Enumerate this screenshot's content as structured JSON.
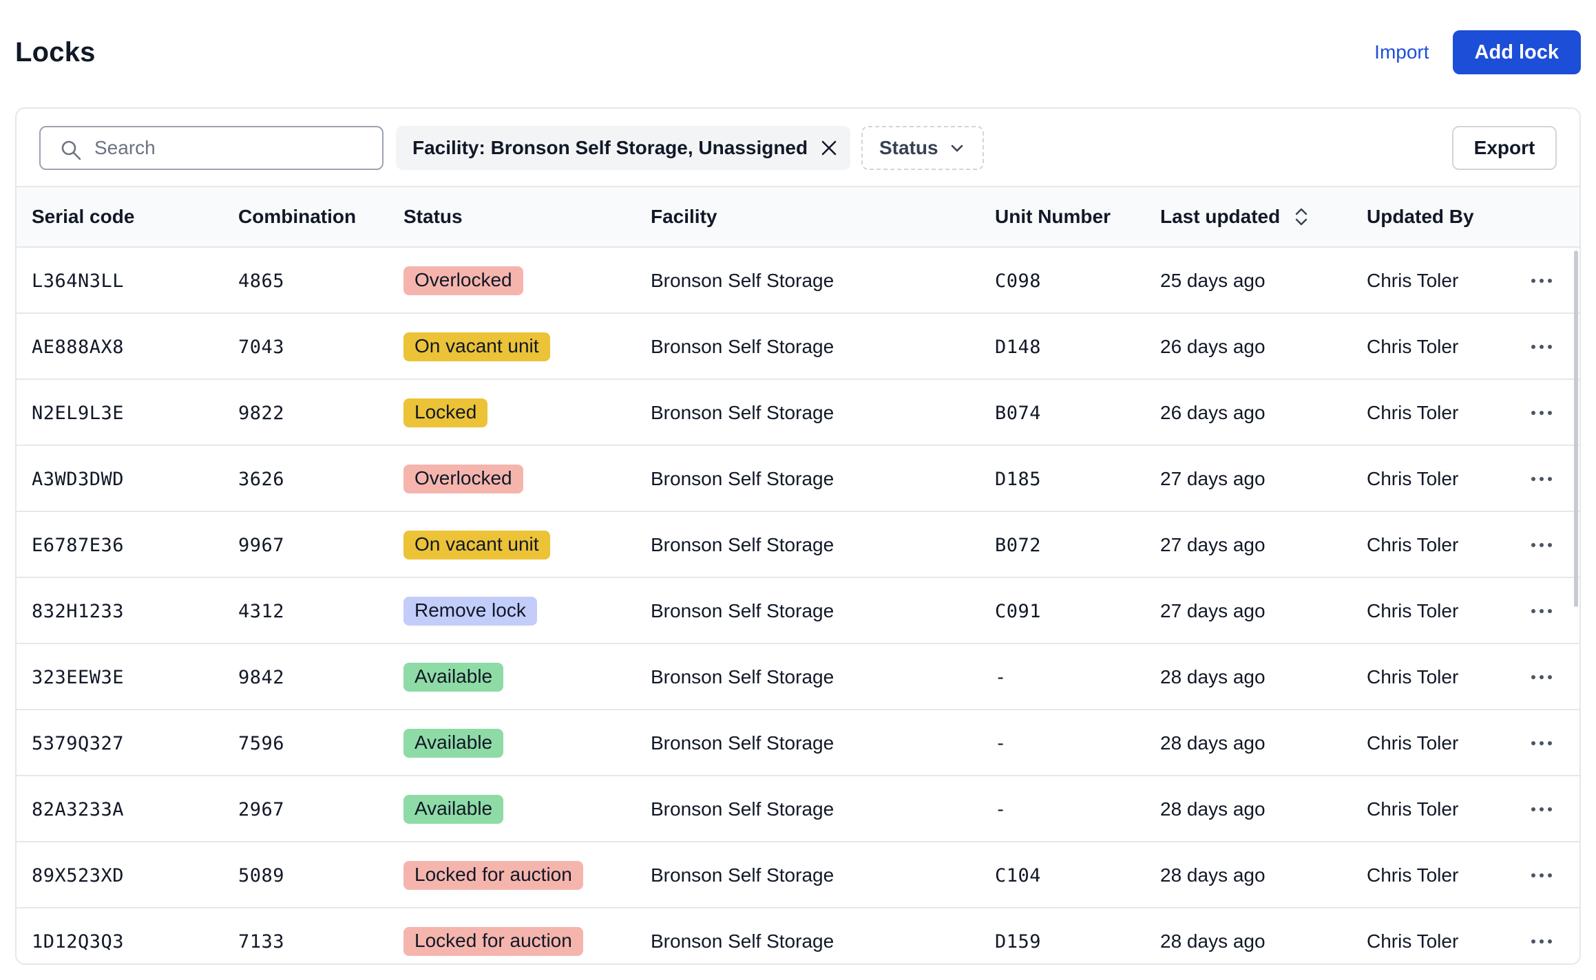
{
  "header": {
    "title": "Locks",
    "import_label": "Import",
    "add_label": "Add lock"
  },
  "toolbar": {
    "search_placeholder": "Search",
    "facility_filter_label": "Facility: Bronson Self Storage, Unassigned",
    "status_filter_label": "Status",
    "export_label": "Export"
  },
  "table": {
    "columns": [
      "Serial code",
      "Combination",
      "Status",
      "Facility",
      "Unit Number",
      "Last updated",
      "Updated By"
    ],
    "sorted_column": "Last updated",
    "rows": [
      {
        "serial": "L364N3LL",
        "combination": "4865",
        "status": "Overlocked",
        "facility": "Bronson Self Storage",
        "unit": "C098",
        "updated": "25 days ago",
        "by": "Chris Toler"
      },
      {
        "serial": "AE888AX8",
        "combination": "7043",
        "status": "On vacant unit",
        "facility": "Bronson Self Storage",
        "unit": "D148",
        "updated": "26 days ago",
        "by": "Chris Toler"
      },
      {
        "serial": "N2EL9L3E",
        "combination": "9822",
        "status": "Locked",
        "facility": "Bronson Self Storage",
        "unit": "B074",
        "updated": "26 days ago",
        "by": "Chris Toler"
      },
      {
        "serial": "A3WD3DWD",
        "combination": "3626",
        "status": "Overlocked",
        "facility": "Bronson Self Storage",
        "unit": "D185",
        "updated": "27 days ago",
        "by": "Chris Toler"
      },
      {
        "serial": "E6787E36",
        "combination": "9967",
        "status": "On vacant unit",
        "facility": "Bronson Self Storage",
        "unit": "B072",
        "updated": "27 days ago",
        "by": "Chris Toler"
      },
      {
        "serial": "832H1233",
        "combination": "4312",
        "status": "Remove lock",
        "facility": "Bronson Self Storage",
        "unit": "C091",
        "updated": "27 days ago",
        "by": "Chris Toler"
      },
      {
        "serial": "323EEW3E",
        "combination": "9842",
        "status": "Available",
        "facility": "Bronson Self Storage",
        "unit": "-",
        "updated": "28 days ago",
        "by": "Chris Toler"
      },
      {
        "serial": "5379Q327",
        "combination": "7596",
        "status": "Available",
        "facility": "Bronson Self Storage",
        "unit": "-",
        "updated": "28 days ago",
        "by": "Chris Toler"
      },
      {
        "serial": "82A3233A",
        "combination": "2967",
        "status": "Available",
        "facility": "Bronson Self Storage",
        "unit": "-",
        "updated": "28 days ago",
        "by": "Chris Toler"
      },
      {
        "serial": "89X523XD",
        "combination": "5089",
        "status": "Locked for auction",
        "facility": "Bronson Self Storage",
        "unit": "C104",
        "updated": "28 days ago",
        "by": "Chris Toler"
      },
      {
        "serial": "1D12Q3Q3",
        "combination": "7133",
        "status": "Locked for auction",
        "facility": "Bronson Self Storage",
        "unit": "D159",
        "updated": "28 days ago",
        "by": "Chris Toler"
      }
    ]
  },
  "status_colors": {
    "Overlocked": {
      "bg": "#f5b5ad",
      "fg": "#111827"
    },
    "On vacant unit": {
      "bg": "#ecc237",
      "fg": "#111827"
    },
    "Locked": {
      "bg": "#ecc237",
      "fg": "#111827"
    },
    "Remove lock": {
      "bg": "#c3cdfa",
      "fg": "#111827"
    },
    "Available": {
      "bg": "#8edba6",
      "fg": "#111827"
    },
    "Locked for auction": {
      "bg": "#f5b5ad",
      "fg": "#111827"
    }
  },
  "colors": {
    "primary": "#1d4ed8",
    "border": "#e5e7eb",
    "header_bg": "#f9fafb"
  }
}
